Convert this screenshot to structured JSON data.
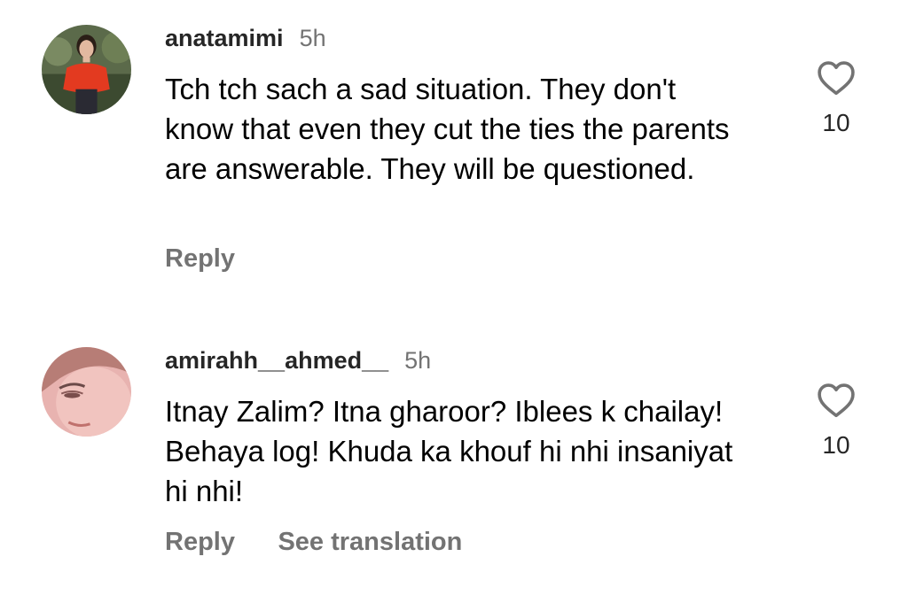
{
  "comments": [
    {
      "username": "anatamimi",
      "time": "5h",
      "text": "Tch tch sach a sad situation. They don't know that even they cut the ties the parents are answerable. They will be questioned.",
      "likes": "10",
      "actions": {
        "reply": "Reply"
      },
      "avatar_icon": "profile-photo-red-top"
    },
    {
      "username": "amirahh__ahmed__",
      "time": "5h",
      "text": "Itnay Zalim? Itna gharoor? Iblees k chailay! Behaya log! Khuda ka khouf hi nhi insaniyat hi nhi!",
      "likes": "10",
      "actions": {
        "reply": "Reply",
        "translate": "See translation"
      },
      "avatar_icon": "profile-photo-face-closeup"
    }
  ],
  "colors": {
    "username": "#262626",
    "secondary": "#737373",
    "text": "#000000",
    "background": "#ffffff"
  },
  "icons": {
    "like": "heart-outline-icon"
  }
}
